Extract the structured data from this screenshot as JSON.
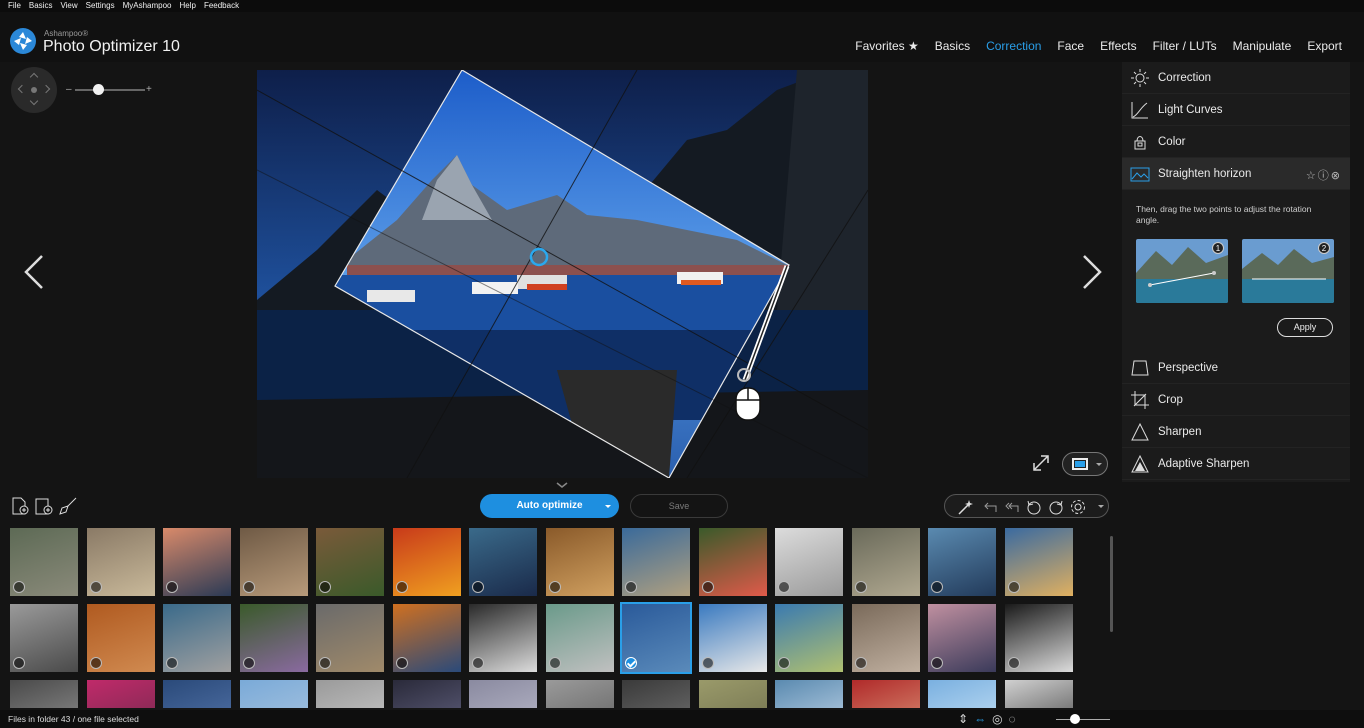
{
  "menu": [
    "File",
    "Basics",
    "View",
    "Settings",
    "MyAshampoo",
    "Help",
    "Feedback"
  ],
  "app": {
    "brand_sub": "Ashampoo®",
    "title": "Photo Optimizer 10"
  },
  "topnav": [
    "Favorites ★",
    "Basics",
    "Correction",
    "Face",
    "Effects",
    "Filter / LUTs",
    "Manipulate",
    "Export"
  ],
  "topnav_active": "Correction",
  "zoom": {
    "minus": "–",
    "plus": "+"
  },
  "panel": {
    "items": [
      {
        "label": "Correction",
        "icon": "sun-icon"
      },
      {
        "label": "Light Curves",
        "icon": "curve-icon"
      },
      {
        "label": "Color",
        "icon": "color-bucket-icon"
      },
      {
        "label": "Straighten horizon",
        "icon": "horizon-icon"
      },
      {
        "label": "Perspective",
        "icon": "perspective-icon"
      },
      {
        "label": "Crop",
        "icon": "crop-icon"
      },
      {
        "label": "Sharpen",
        "icon": "sharpen-icon"
      },
      {
        "label": "Adaptive Sharpen",
        "icon": "adaptive-sharpen-icon"
      }
    ],
    "straighten_icons": "☆ⓘ⊗",
    "hint": "Then, drag the two points to adjust the rotation angle.",
    "example_1": "1",
    "example_2": "2",
    "apply": "Apply"
  },
  "toolbar": {
    "auto_optimize": "Auto optimize",
    "save": "Save"
  },
  "status": {
    "text": "Files in folder 43 / one file selected"
  },
  "colors": {
    "accent": "#2a9fe8",
    "button": "#1e8fe0",
    "panel": "#1b1b1b",
    "background": "#141414"
  },
  "thumbnails": [
    [
      "#5d6a55",
      "#8a8a7a"
    ],
    [
      "#8a7a66",
      "#c9b99a"
    ],
    [
      "#d98a6a",
      "#2b3a55"
    ],
    [
      "#6f5a45",
      "#b79a7a"
    ],
    [
      "#7a5a3a",
      "#3a5a2a"
    ],
    [
      "#c83a1a",
      "#f0a020"
    ],
    [
      "#3a6a8a",
      "#1a2a4a"
    ],
    [
      "#8a5a2a",
      "#d0a060"
    ],
    [
      "#3a6a9a",
      "#b0a080"
    ],
    [
      "#3a5a2a",
      "#e05a4a"
    ],
    [
      "#dcdcdc",
      "#9a9a9a"
    ],
    [
      "#6a6a5a",
      "#b0a890"
    ],
    [
      "#5a8ab0",
      "#223a5a"
    ],
    [
      "#3a6aa0",
      "#e0b060"
    ],
    [
      "#9a9a9a",
      "#4a4a4a"
    ],
    [
      "#b05a20",
      "#d08a50"
    ],
    [
      "#3a6a8a",
      "#a0a0a0"
    ],
    [
      "#3a5a2a",
      "#8a6aa0"
    ],
    [
      "#6a6a6a",
      "#a08a6a"
    ],
    [
      "#d07020",
      "#2a4a7a"
    ],
    [
      "#2a2a2a",
      "#dcdcdc"
    ],
    [
      "#6a9a8a",
      "#c0c0c0"
    ],
    [
      "#2a5a9a",
      "#5a8aba"
    ],
    [
      "#3a7ac0",
      "#e8e8e8"
    ],
    [
      "#3a7ab0",
      "#b0c070"
    ],
    [
      "#7a6a5a",
      "#c0b0a0"
    ],
    [
      "#c090a0",
      "#3a3a5a"
    ],
    [
      "#1a1a1a",
      "#dcdcdc"
    ],
    [
      "#4a4a4a",
      "#9a9a9a"
    ],
    [
      "#c02a6a",
      "#6a2a4a"
    ],
    [
      "#2a4a7a",
      "#5a7ab0"
    ],
    [
      "#7aaad8",
      "#b0c8e0"
    ],
    [
      "#9a9a9a",
      "#d0d0d0"
    ],
    [
      "#2a2a3a",
      "#6a6a8a"
    ],
    [
      "#8a8aa0",
      "#c0c0d0"
    ],
    [
      "#9a9a9a",
      "#5a5a5a"
    ],
    [
      "#3a3a3a",
      "#7a7a7a"
    ],
    [
      "#9a9a6a",
      "#6a6a4a"
    ],
    [
      "#5a8ab0",
      "#d0e0f0"
    ],
    [
      "#b02a2a",
      "#e0a080"
    ],
    [
      "#7ab0e0",
      "#d0e8f8"
    ],
    [
      "#d0d0d0",
      "#3a3a3a"
    ]
  ],
  "selected_thumbnail": 22
}
